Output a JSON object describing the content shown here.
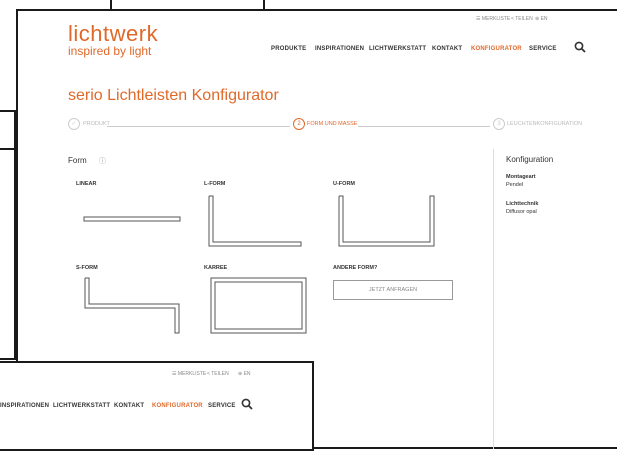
{
  "brand": {
    "name": "lichtwerk",
    "tagline": "inspired by light",
    "accent": "#e0692a"
  },
  "utility_links": [
    {
      "icon": "list-icon",
      "label": "MERKLISTE"
    },
    {
      "icon": "share-icon",
      "label": "TEILEN"
    },
    {
      "icon": "globe-icon",
      "label": "EN"
    }
  ],
  "nav": [
    {
      "label": "PRODUKTE",
      "active": false
    },
    {
      "label": "INSPIRATIONEN",
      "active": false
    },
    {
      "label": "LICHTWERKSTATT",
      "active": false
    },
    {
      "label": "KONTAKT",
      "active": false
    },
    {
      "label": "KONFIGURATOR",
      "active": true
    },
    {
      "label": "SERVICE",
      "active": false
    }
  ],
  "overlay_nav": [
    {
      "label": "INSPIRATIONEN",
      "active": false
    },
    {
      "label": "LICHTWERKSTATT",
      "active": false
    },
    {
      "label": "KONTAKT",
      "active": false
    },
    {
      "label": "KONFIGURATOR",
      "active": true
    },
    {
      "label": "SERVICE",
      "active": false
    }
  ],
  "page_title": "serio Lichtleisten Konfigurator",
  "steps": [
    {
      "num": "✓",
      "label": "PRODUKT",
      "state": "done"
    },
    {
      "num": "2",
      "label": "FORM UND MASSE",
      "state": "active"
    },
    {
      "num": "3",
      "label": "LEUCHTENKONFIGURATION",
      "state": "upcoming"
    }
  ],
  "form_section": {
    "heading": "Form",
    "info_icon": "info-icon"
  },
  "shapes": [
    {
      "label": "LINEAR",
      "icon": "linear-shape-icon"
    },
    {
      "label": "L-FORM",
      "icon": "l-shape-icon"
    },
    {
      "label": "U-FORM",
      "icon": "u-shape-icon"
    },
    {
      "label": "S-FORM",
      "icon": "s-shape-icon"
    },
    {
      "label": "KARREE",
      "icon": "square-shape-icon"
    },
    {
      "label": "ANDERE FORM?",
      "icon": ""
    }
  ],
  "request_button": "JETZT ANFRAGEN",
  "sidebar": {
    "heading": "Konfiguration",
    "items": [
      {
        "key": "Montageart",
        "value": "Pendel"
      },
      {
        "key": "Lichttechnik",
        "value": "Diffusor opal"
      }
    ]
  }
}
